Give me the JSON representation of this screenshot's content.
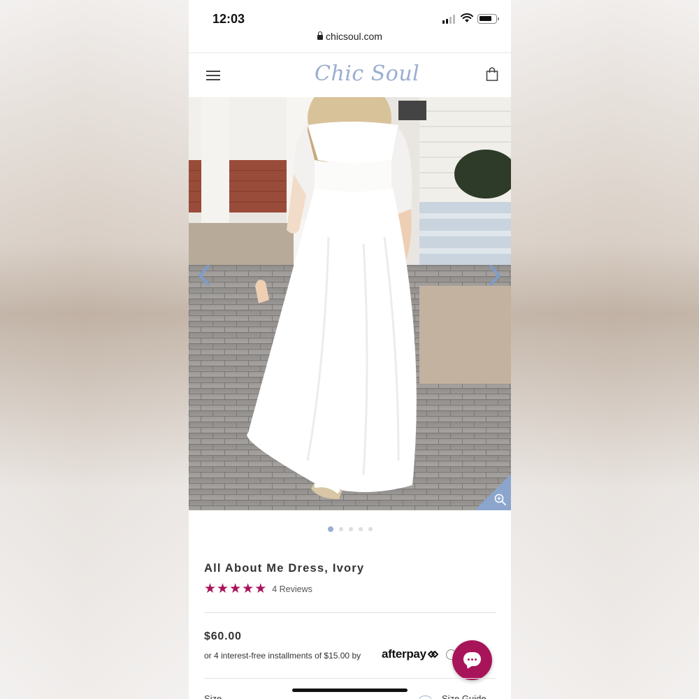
{
  "status_bar": {
    "time": "12:03"
  },
  "browser": {
    "url": "chicsoul.com"
  },
  "header": {
    "logo_text": "Chic Soul",
    "menu_icon": "hamburger-icon",
    "cart_icon": "shopping-bag-icon"
  },
  "gallery": {
    "image_description_icon": "product-photo",
    "prev_icon": "chevron-left-icon",
    "next_icon": "chevron-right-icon",
    "zoom_icon": "zoom-in-icon",
    "total_slides": 5,
    "active_slide": 1
  },
  "product": {
    "title": "All About Me Dress, Ivory",
    "rating": 5,
    "rating_max": 5,
    "reviews_label": "4 Reviews",
    "price": "$60.00",
    "installments_text": "or 4 interest-free installments of $15.00 by",
    "afterpay_label": "afterpay",
    "size_label": "Size",
    "size_guide_label": "Size Guide"
  },
  "colors": {
    "accent": "#a8145a",
    "logo": "#9aaed0",
    "carousel_arrow": "#7f9cc7"
  }
}
